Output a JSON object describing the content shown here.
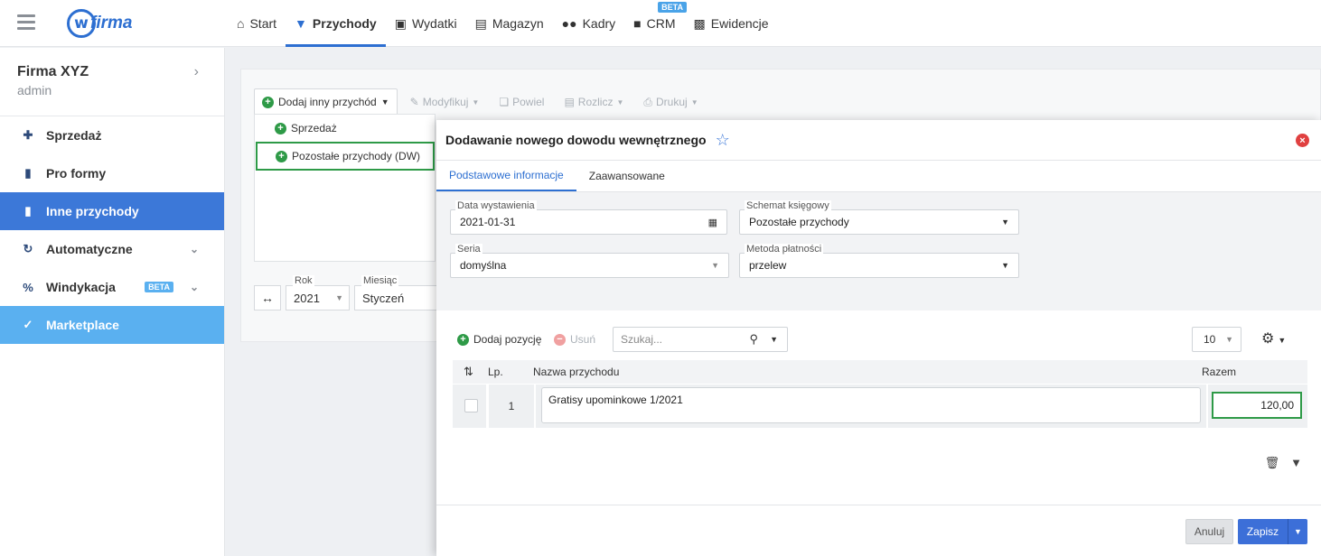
{
  "colors": {
    "brand": "#2d6fd1",
    "active": "#3c78d8",
    "marketplace": "#5ab0f0",
    "green": "#2e9a47",
    "danger": "#e04040"
  },
  "logo": {
    "text": "firma",
    "mark": "w"
  },
  "nav": [
    {
      "label": "Start",
      "icon": "home-icon"
    },
    {
      "label": "Przychody",
      "icon": "hand-coin-icon",
      "active": true
    },
    {
      "label": "Wydatki",
      "icon": "wallet-icon"
    },
    {
      "label": "Magazyn",
      "icon": "warehouse-icon"
    },
    {
      "label": "Kadry",
      "icon": "users-icon"
    },
    {
      "label": "CRM",
      "icon": "contact-book-icon",
      "badge": "BETA"
    },
    {
      "label": "Ewidencje",
      "icon": "folder-open-icon"
    }
  ],
  "company": {
    "name": "Firma XYZ",
    "user": "admin"
  },
  "sidebar": [
    {
      "label": "Sprzedaż",
      "icon": "plus-square-icon"
    },
    {
      "label": "Pro formy",
      "icon": "document-icon"
    },
    {
      "label": "Inne przychody",
      "icon": "document-import-icon",
      "active": true
    },
    {
      "label": "Automatyczne",
      "icon": "refresh-icon"
    },
    {
      "label": "Windykacja",
      "icon": "percent-icon",
      "badge": "BETA"
    },
    {
      "label": "Marketplace",
      "icon": "cart-icon"
    }
  ],
  "toolbar": {
    "add_other": "Dodaj inny przychód",
    "modify": "Modyfikuj",
    "repeat": "Powiel",
    "settle": "Rozlicz",
    "print": "Drukuj"
  },
  "add_menu": {
    "items": [
      "Sprzedaż",
      "Pozostałe przychody (DW)"
    ]
  },
  "filters": {
    "year_label": "Rok",
    "year_value": "2021",
    "month_label": "Miesiąc",
    "month_value": "Styczeń"
  },
  "modal": {
    "title": "Dodawanie nowego dowodu wewnętrznego",
    "tabs": [
      "Podstawowe informacje",
      "Zaawansowane"
    ],
    "fields": {
      "date_label": "Data wystawienia",
      "date_value": "2021-01-31",
      "scheme_label": "Schemat księgowy",
      "scheme_value": "Pozostałe przychody",
      "series_label": "Seria",
      "series_value": "domyślna",
      "payment_label": "Metoda płatności",
      "payment_value": "przelew"
    },
    "items_toolbar": {
      "add": "Dodaj pozycję",
      "remove": "Usuń",
      "search_placeholder": "Szukaj...",
      "page_size": "10"
    },
    "table": {
      "headers": {
        "lp": "Lp.",
        "name": "Nazwa przychodu",
        "total": "Razem"
      },
      "rows": [
        {
          "lp": "1",
          "name": "Gratisy upominkowe 1/2021",
          "total": "120,00"
        }
      ]
    },
    "footer": {
      "cancel": "Anuluj",
      "save": "Zapisz"
    }
  }
}
